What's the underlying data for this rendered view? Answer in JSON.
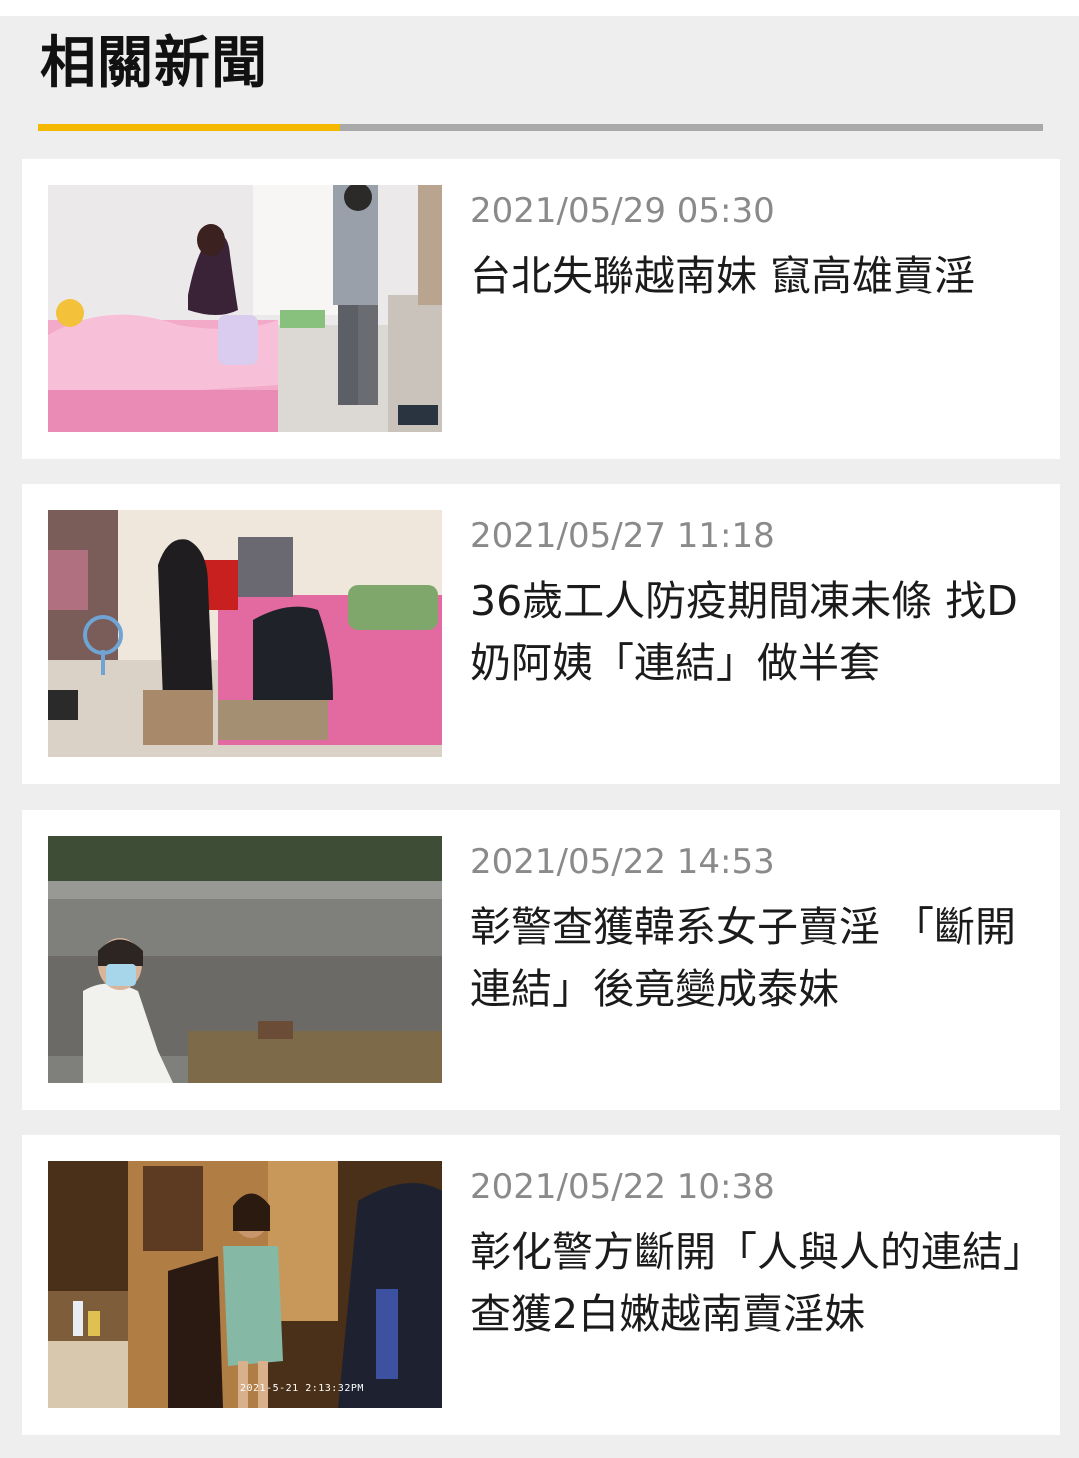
{
  "section": {
    "title": "相關新聞",
    "accent_color": "#f5b800",
    "line_color": "#a9a9a9"
  },
  "articles": [
    {
      "date": "2021/05/29 05:30",
      "headline": "台北失聯越南妹 竄高雄賣淫",
      "thumbnail": "photo-woman-on-pink-bed-officer-standing"
    },
    {
      "date": "2021/05/27 11:18",
      "headline": "36歲工人防疫期間凍未條 找D奶阿姨「連結」做半套",
      "thumbnail": "photo-two-people-seated-on-bed-with-fan"
    },
    {
      "date": "2021/05/22 14:53",
      "headline": "彰警查獲韓系女子賣淫 「斷開連結」後竟變成泰妹",
      "thumbnail": "photo-masked-woman-seated-by-concrete-wall"
    },
    {
      "date": "2021/05/22 10:38",
      "headline": "彰化警方斷開「人與人的連結」查獲2白嫩越南賣淫妹",
      "thumbnail": "photo-woman-in-towel-in-wooden-room",
      "thumbnail_timestamp": "2021-5-21  2:13:32PM"
    }
  ]
}
